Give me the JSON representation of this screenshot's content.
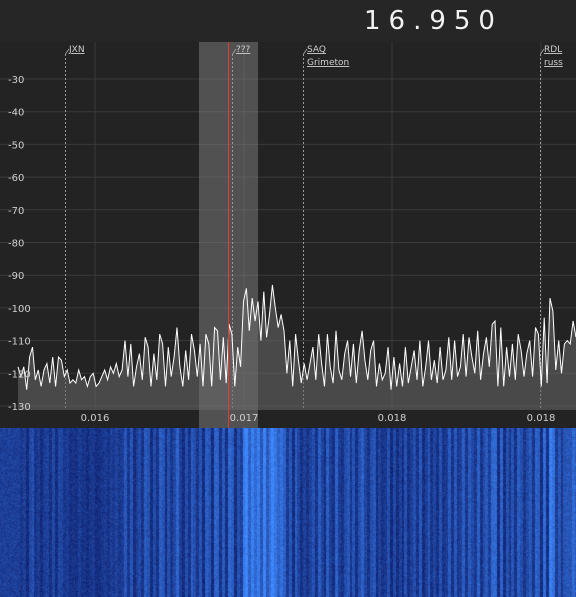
{
  "frequency_display": "16.950",
  "colors": {
    "background": "#232323",
    "trace": "#ffffff",
    "trace_fill": "#6a6a6a",
    "passband": "#8a8a8a",
    "tuned_marker": "#e23a3a",
    "grid": "#3a3a3a",
    "label": "#cfcfcf",
    "waterfall_base": "#0a1a8c",
    "waterfall_hot": "#3a7bff"
  },
  "y_axis": {
    "unit": "dB",
    "ticks": [
      "-30",
      "-40",
      "-50",
      "-60",
      "-70",
      "-80",
      "-90",
      "-100",
      "-110",
      "-120",
      "-130"
    ]
  },
  "x_axis": {
    "ticks": [
      "0.016",
      "0.017",
      "0.018",
      "0.018"
    ]
  },
  "stations": [
    {
      "name": "JXN",
      "note": ""
    },
    {
      "name": "???",
      "note": ""
    },
    {
      "name": "SAQ",
      "note": "Grimeton"
    },
    {
      "name": "RDL",
      "note": "russ"
    }
  ],
  "chart_data": {
    "type": "line",
    "title": "",
    "xlabel": "",
    "ylabel": "",
    "ylim": [
      -133,
      -23
    ],
    "tuned_frequency": 16.95,
    "series": [
      {
        "values": [
          -118,
          -121,
          -118,
          -125,
          -115,
          -112,
          -122,
          -119,
          -124,
          -119,
          -117,
          -123,
          -115,
          -124,
          -115,
          -116,
          -121,
          -119,
          -123,
          -122,
          -123,
          -119,
          -122,
          -121,
          -124,
          -121,
          -120,
          -124,
          -123,
          -121,
          -119,
          -122,
          -118,
          -120,
          -117,
          -121,
          -119,
          -110,
          -121,
          -111,
          -124,
          -118,
          -114,
          -122,
          -109,
          -112,
          -124,
          -114,
          -122,
          -108,
          -111,
          -124,
          -112,
          -121,
          -115,
          -106,
          -118,
          -124,
          -113,
          -122,
          -108,
          -113,
          -121,
          -111,
          -124,
          -108,
          -111,
          -124,
          -106,
          -107,
          -122,
          -109,
          -123,
          -105,
          -108,
          -124,
          -112,
          -118,
          -98,
          -94,
          -107,
          -97,
          -104,
          -98,
          -110,
          -95,
          -109,
          -102,
          -93,
          -100,
          -106,
          -102,
          -107,
          -120,
          -110,
          -124,
          -108,
          -116,
          -123,
          -117,
          -122,
          -117,
          -112,
          -122,
          -108,
          -117,
          -124,
          -108,
          -118,
          -123,
          -107,
          -119,
          -122,
          -114,
          -110,
          -121,
          -111,
          -123,
          -113,
          -107,
          -116,
          -122,
          -113,
          -110,
          -124,
          -117,
          -122,
          -120,
          -112,
          -125,
          -115,
          -124,
          -117,
          -124,
          -112,
          -123,
          -118,
          -113,
          -122,
          -110,
          -124,
          -118,
          -110,
          -122,
          -116,
          -123,
          -112,
          -122,
          -119,
          -109,
          -122,
          -110,
          -121,
          -118,
          -108,
          -121,
          -109,
          -115,
          -120,
          -107,
          -122,
          -114,
          -109,
          -118,
          -105,
          -104,
          -124,
          -106,
          -124,
          -112,
          -121,
          -111,
          -122,
          -108,
          -113,
          -121,
          -114,
          -110,
          -121,
          -106,
          -108,
          -124,
          -103,
          -123,
          -97,
          -101,
          -119,
          -110,
          -120,
          -111,
          -110,
          -111,
          -104,
          -109
        ]
      }
    ]
  }
}
